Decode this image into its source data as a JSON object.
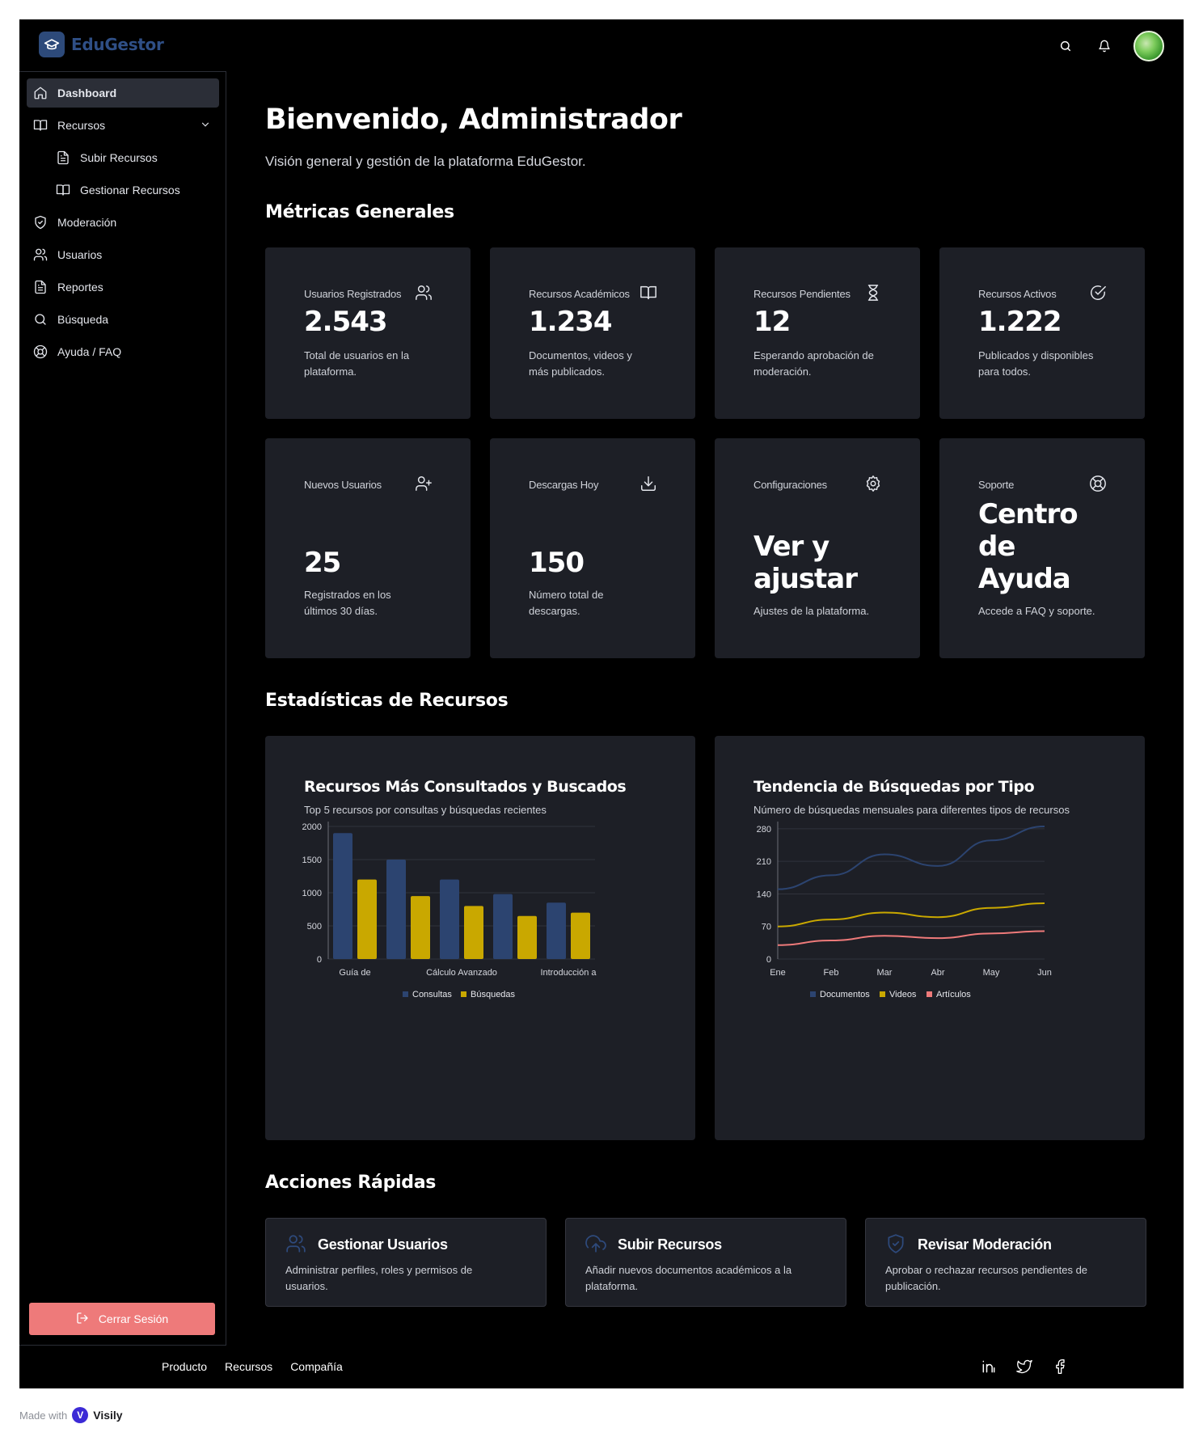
{
  "brand": {
    "name": "EduGestor"
  },
  "topbar": {
    "search_icon": "search-icon",
    "bell_icon": "bell-icon"
  },
  "sidebar": {
    "items": [
      {
        "label": "Dashboard",
        "icon": "home-icon"
      },
      {
        "label": "Recursos",
        "icon": "book-open-icon"
      },
      {
        "label": "Subir Recursos",
        "icon": "file-text-icon"
      },
      {
        "label": "Gestionar Recursos",
        "icon": "book-open-icon"
      },
      {
        "label": "Moderación",
        "icon": "shield-check-icon"
      },
      {
        "label": "Usuarios",
        "icon": "users-icon"
      },
      {
        "label": "Reportes",
        "icon": "file-text-icon"
      },
      {
        "label": "Búsqueda",
        "icon": "search-icon"
      },
      {
        "label": "Ayuda / FAQ",
        "icon": "life-buoy-icon"
      }
    ],
    "logout_label": "Cerrar Sesión"
  },
  "main": {
    "title": "Bienvenido, Administrador",
    "subtitle": "Visión general y gestión de la plataforma EduGestor.",
    "metrics_title": "Métricas Generales",
    "stats_title": "Estadísticas de Recursos",
    "actions_title": "Acciones Rápidas"
  },
  "metrics": [
    {
      "label": "Usuarios Registrados",
      "value": "2.543",
      "desc": "Total de usuarios en la plataforma.",
      "icon": "users-icon"
    },
    {
      "label": "Recursos Académicos",
      "value": "1.234",
      "desc": "Documentos, videos y más publicados.",
      "icon": "book-open-icon"
    },
    {
      "label": "Recursos Pendientes",
      "value": "12",
      "desc": "Esperando aprobación de moderación.",
      "icon": "hourglass-icon"
    },
    {
      "label": "Recursos Activos",
      "value": "1.222",
      "desc": "Publicados y disponibles para todos.",
      "icon": "check-circle-icon"
    },
    {
      "label": "Nuevos Usuarios",
      "value": "25",
      "desc": "Registrados en los últimos 30 días.",
      "icon": "user-plus-icon"
    },
    {
      "label": "Descargas Hoy",
      "value": "150",
      "desc": "Número total de descargas.",
      "icon": "download-icon"
    },
    {
      "label": "Configuraciones",
      "value": "Ver y ajustar",
      "desc": "Ajustes de la plataforma.",
      "icon": "settings-icon"
    },
    {
      "label": "Soporte",
      "value": "Centro de Ayuda",
      "desc": "Accede a FAQ y soporte.",
      "icon": "life-buoy-icon"
    }
  ],
  "charts": {
    "bar": {
      "title": "Recursos Más Consultados y Buscados",
      "subtitle": "Top 5 recursos por consultas y búsquedas recientes"
    },
    "line": {
      "title": "Tendencia de Búsquedas por Tipo",
      "subtitle": "Número de búsquedas mensuales para diferentes tipos de recursos"
    }
  },
  "chart_data": [
    {
      "type": "bar",
      "title": "Recursos Más Consultados y Buscados",
      "categories": [
        "Guía de",
        "",
        "Cálculo Avanzado",
        "",
        "Introducción a"
      ],
      "series": [
        {
          "name": "Consultas",
          "values": [
            1900,
            1500,
            1200,
            980,
            850
          ],
          "color": "#2c4470"
        },
        {
          "name": "Búsquedas",
          "values": [
            1200,
            950,
            800,
            650,
            700
          ],
          "color": "#c9a800"
        }
      ],
      "yticks": [
        0,
        500,
        1000,
        1500,
        2000
      ],
      "ylim": [
        0,
        2000
      ],
      "grid": true,
      "legend": "bottom"
    },
    {
      "type": "line",
      "title": "Tendencia de Búsquedas por Tipo",
      "x": [
        "Ene",
        "Feb",
        "Mar",
        "Abr",
        "May",
        "Jun"
      ],
      "series": [
        {
          "name": "Documentos",
          "values": [
            150,
            180,
            225,
            200,
            255,
            285
          ],
          "color": "#2c4470"
        },
        {
          "name": "Videos",
          "values": [
            70,
            85,
            100,
            90,
            110,
            120
          ],
          "color": "#c9a800"
        },
        {
          "name": "Artículos",
          "values": [
            30,
            40,
            50,
            45,
            55,
            60
          ],
          "color": "#ee7a7a"
        }
      ],
      "yticks": [
        0,
        70,
        140,
        210,
        280
      ],
      "ylim": [
        0,
        285
      ],
      "grid": true,
      "legend": "bottom"
    }
  ],
  "quick_actions": [
    {
      "title": "Gestionar Usuarios",
      "desc": "Administrar perfiles, roles y permisos de usuarios.",
      "icon": "users-icon"
    },
    {
      "title": "Subir Recursos",
      "desc": "Añadir nuevos documentos académicos a la plataforma.",
      "icon": "cloud-upload-icon"
    },
    {
      "title": "Revisar Moderación",
      "desc": "Aprobar o rechazar recursos pendientes de publicación.",
      "icon": "shield-check-icon"
    }
  ],
  "footer": {
    "links": [
      "Producto",
      "Recursos",
      "Compañía"
    ],
    "socials": [
      "linkedin-icon",
      "twitter-icon",
      "facebook-icon"
    ]
  },
  "made_with": {
    "prefix": "Made with",
    "brand": "Visily"
  },
  "colors": {
    "accent": "#2c4470",
    "yellow": "#c9a800",
    "danger": "#ee7a7a",
    "card": "#1d1f26"
  }
}
